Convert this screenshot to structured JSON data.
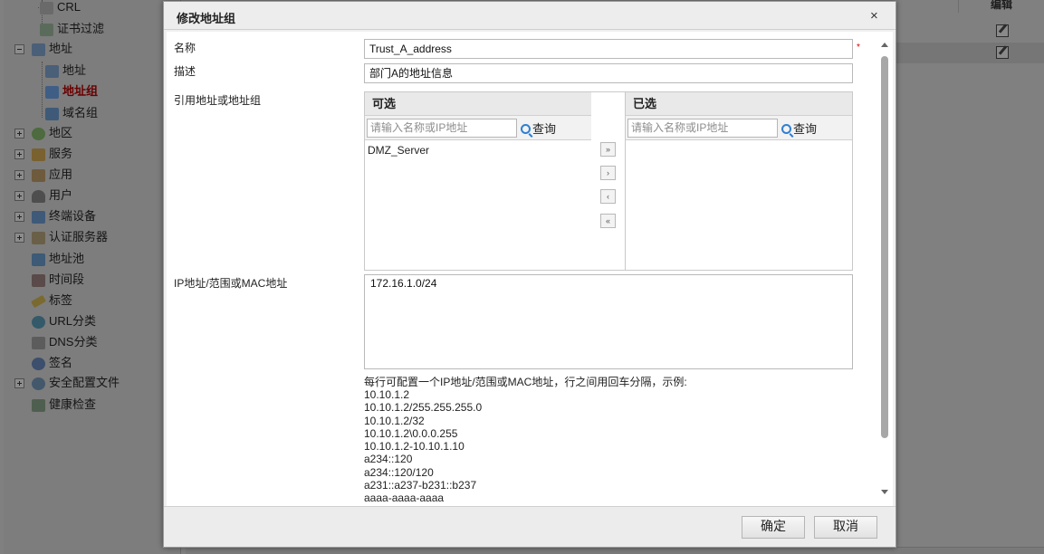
{
  "background": {
    "sidebar_items": [
      {
        "label": "CRL",
        "icon": "crl-icon",
        "indent": 1
      },
      {
        "label": "证书过滤",
        "icon": "cert-filter-icon",
        "indent": 1
      },
      {
        "label": "地址",
        "icon": "address-icon",
        "indent": 0,
        "expander": "minus"
      },
      {
        "label": "地址",
        "icon": "address-item-icon",
        "indent": 1
      },
      {
        "label": "地址组",
        "icon": "address-group-icon",
        "indent": 1,
        "selected": true
      },
      {
        "label": "域名组",
        "icon": "domain-group-icon",
        "indent": 1
      },
      {
        "label": "地区",
        "icon": "region-icon",
        "indent": 0,
        "expander": "plus"
      },
      {
        "label": "服务",
        "icon": "service-icon",
        "indent": 0,
        "expander": "plus"
      },
      {
        "label": "应用",
        "icon": "application-icon",
        "indent": 0,
        "expander": "plus"
      },
      {
        "label": "用户",
        "icon": "user-icon",
        "indent": 0,
        "expander": "plus"
      },
      {
        "label": "终端设备",
        "icon": "terminal-device-icon",
        "indent": 0,
        "expander": "plus"
      },
      {
        "label": "认证服务器",
        "icon": "auth-server-icon",
        "indent": 0,
        "expander": "plus"
      },
      {
        "label": "地址池",
        "icon": "address-pool-icon",
        "indent": 0
      },
      {
        "label": "时间段",
        "icon": "schedule-icon",
        "indent": 0
      },
      {
        "label": "标签",
        "icon": "tag-icon",
        "indent": 0
      },
      {
        "label": "URL分类",
        "icon": "url-category-icon",
        "indent": 0
      },
      {
        "label": "DNS分类",
        "icon": "dns-category-icon",
        "indent": 0
      },
      {
        "label": "签名",
        "icon": "signature-icon",
        "indent": 0
      },
      {
        "label": "安全配置文件",
        "icon": "security-profile-icon",
        "indent": 0,
        "expander": "plus"
      },
      {
        "label": "健康检查",
        "icon": "health-check-icon",
        "indent": 0
      }
    ],
    "edit_column_header": "编辑"
  },
  "dialog": {
    "title": "修改地址组",
    "close_glyph": "×",
    "name_label": "名称",
    "name_value": "Trust_A_address",
    "required_mark": "*",
    "desc_label": "描述",
    "desc_value": "部门A的地址信息",
    "ref_label": "引用地址或地址组",
    "available": {
      "title": "可选",
      "search_placeholder": "请输入名称或IP地址",
      "search_button": "查询",
      "items": [
        "DMZ_Server"
      ]
    },
    "selected": {
      "title": "已选",
      "search_placeholder": "请输入名称或IP地址",
      "search_button": "查询",
      "items": []
    },
    "move_buttons": {
      "add_all": "»",
      "add": "›",
      "remove": "‹",
      "remove_all": "«"
    },
    "ip_label": "IP地址/范围或MAC地址",
    "ip_value": "172.16.1.0/24",
    "hint_title": "每行可配置一个IP地址/范围或MAC地址，行之间用回车分隔，示例:",
    "hint_examples": "10.10.1.2\n10.10.1.2/255.255.255.0\n10.10.1.2/32\n10.10.1.2\\0.0.0.255\n10.10.1.2-10.10.1.10\na234::120\na234::120/120\na231::a237-b231::b237\naaaa-aaaa-aaaa",
    "ok_label": "确定",
    "cancel_label": "取消"
  }
}
